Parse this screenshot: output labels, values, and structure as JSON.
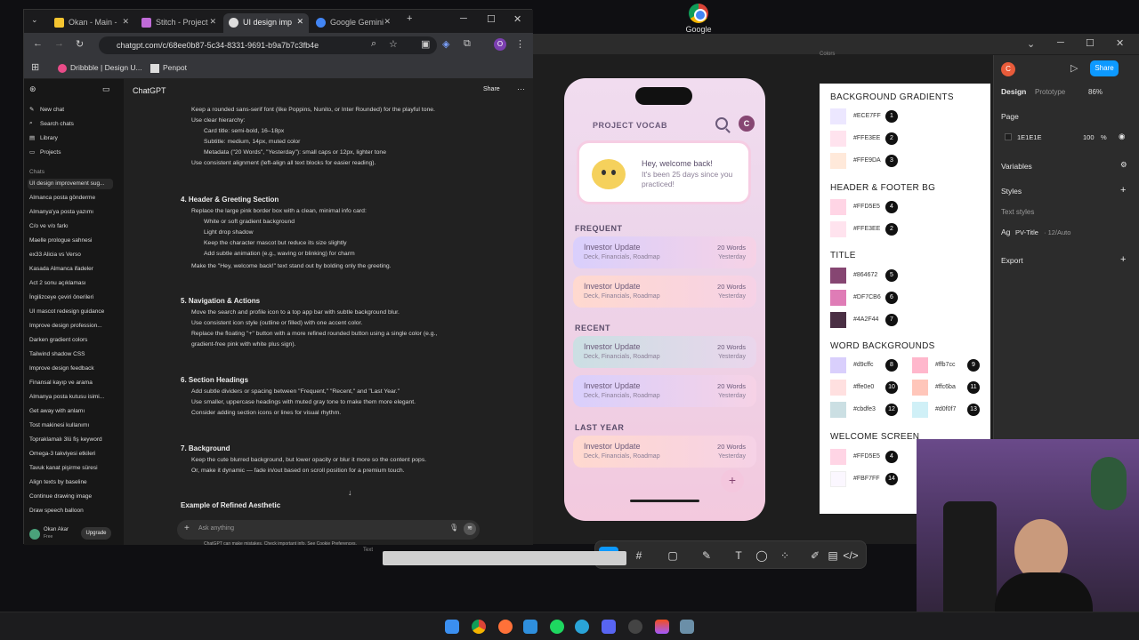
{
  "desktop": {
    "icon_label": "Google"
  },
  "browser": {
    "tabs": [
      {
        "label": "Okan - Main -"
      },
      {
        "label": "Stitch - Project"
      },
      {
        "label": "UI design imp"
      },
      {
        "label": "Google Gemini"
      }
    ],
    "url": "chatgpt.com/c/68ee0b87-5c34-8331-9691-b9a7b7c3fb4e",
    "bookmarks": [
      "Dribbble | Design U...",
      "Penpot"
    ],
    "profile_initial": "O"
  },
  "chatgpt": {
    "model_label": "ChatGPT",
    "share_label": "Share",
    "sidebar": {
      "actions": [
        "New chat",
        "Search chats",
        "Library",
        "Projects"
      ],
      "chats_header": "Chats",
      "chats": [
        "UI design improvement sug...",
        "Almanca posta gönderme",
        "Almanya'ya posta yazımı",
        "C/o ve v/o farkı",
        "Maelle prologue sahnesi",
        "ex33 Alicia vs Verso",
        "Kasada Almanca ifadeler",
        "Act 2 sonu açıklaması",
        "İngilizceye çeviri önerileri",
        "UI mascot redesign guidance",
        "Improve design profession...",
        "Darken gradient colors",
        "Tailwind shadow CSS",
        "Improve design feedback",
        "Finansal kayıp ve arama",
        "Almanya posta kutusu isimi...",
        "Get away with anlamı",
        "Tost makinesi kullanımı",
        "Topraklamalı 3lü fiş keyword",
        "Omega-3 takviyesi etkileri",
        "Tavuk kanat pişirme süresi",
        "Align texts by baseline",
        "Continue drawing image",
        "Draw speech balloon"
      ],
      "user_name": "Okan Akar",
      "user_plan": "Free",
      "upgrade_label": "Upgrade"
    },
    "content": {
      "lines_top": [
        "Keep a rounded sans-serif font (like Poppins, Nunito, or Inter Rounded) for the playful tone.",
        "Use clear hierarchy:",
        "Card title: semi-bold, 16–18px",
        "Subtitle: medium, 14px, muted color",
        "Metadata (\"20 Words\", \"Yesterday\"): small caps or 12px, lighter tone",
        "Use consistent alignment (left-align all text blocks for easier reading)."
      ],
      "s4_title": "4. Header & Greeting Section",
      "s4_lines": [
        "Replace the large pink border box with a clean, minimal info card:",
        "White or soft gradient background",
        "Light drop shadow",
        "Keep the character mascot but reduce its size slightly",
        "Add subtle animation (e.g., waving or blinking) for charm",
        "Make the \"Hey, welcome back!\" text stand out by bolding only the greeting."
      ],
      "s5_title": "5. Navigation & Actions",
      "s5_lines": [
        "Move the search and profile icon to a top app bar with subtle background blur.",
        "Use consistent icon style (outline or filled) with one accent color.",
        "Replace the floating \"+\" button with a more refined rounded button using a single color (e.g.,",
        "gradient-free pink with white plus sign)."
      ],
      "s6_title": "6. Section Headings",
      "s6_lines": [
        "Add subtle dividers or spacing between \"Frequent,\" \"Recent,\" and \"Last Year.\"",
        "Use smaller, uppercase headings with muted gray tone to make them more elegant.",
        "Consider adding section icons or lines for visual rhythm."
      ],
      "s7_title": "7. Background",
      "s7_lines": [
        "Keep the cute blurred background, but lower opacity or blur it more so the content pops.",
        "Or, make it dynamic — fade in/out based on scroll position for a premium touch."
      ],
      "example_title": "Example of Refined Aesthetic"
    },
    "ask_placeholder": "Ask anything",
    "disclaimer": "ChatGPT can make mistakes. Check important info. See Cookie Preferences."
  },
  "app": {
    "title": "PROJECT VOCAB",
    "avatar_initial": "C",
    "welcome_title": "Hey, welcome back!",
    "welcome_sub": "It's been 25 days since you practiced!",
    "sections": [
      {
        "name": "FREQUENT",
        "cards": [
          {
            "title": "Investor Update",
            "sub": "Deck, Financials, Roadmap",
            "words": "20 Words",
            "when": "Yesterday",
            "color": "#d9cffc"
          },
          {
            "title": "Investor Update",
            "sub": "Deck, Financials, Roadmap",
            "words": "20 Words",
            "when": "Yesterday",
            "color": "#ffc6ba"
          }
        ]
      },
      {
        "name": "RECENT",
        "cards": [
          {
            "title": "Investor Update",
            "sub": "Deck, Financials, Roadmap",
            "words": "20 Words",
            "when": "Yesterday",
            "color": "#cbdfe3"
          },
          {
            "title": "Investor Update",
            "sub": "Deck, Financials, Roadmap",
            "words": "20 Words",
            "when": "Yesterday",
            "color": "#d9cffc"
          }
        ]
      },
      {
        "name": "LAST YEAR",
        "cards": [
          {
            "title": "Investor Update",
            "sub": "Deck, Financials, Roadmap",
            "words": "20 Words",
            "when": "Yesterday",
            "color": "#ffc6ba"
          }
        ]
      }
    ],
    "fab": "+"
  },
  "palette": {
    "groups": [
      {
        "heading": "BACKGROUND GRADIENTS",
        "items": [
          {
            "hex": "#ECE7FF",
            "num": "1"
          },
          {
            "hex": "#FFE3EE",
            "num": "2"
          },
          {
            "hex": "#FFE9DA",
            "num": "3"
          }
        ]
      },
      {
        "heading": "HEADER & FOOTER BG",
        "items": [
          {
            "hex": "#FFD5E5",
            "num": "4"
          },
          {
            "hex": "#FFE3EE",
            "num": "2"
          }
        ]
      },
      {
        "heading": "TITLE",
        "items": [
          {
            "hex": "#864672",
            "num": "5"
          },
          {
            "hex": "#DF7CB6",
            "num": "6"
          },
          {
            "hex": "#4A2F44",
            "num": "7"
          }
        ]
      }
    ],
    "word_bg_heading": "WORD BACKGROUNDS",
    "word_bg": [
      {
        "hex": "#d9cffc",
        "num": "8"
      },
      {
        "hex": "#ffb7cc",
        "num": "9"
      },
      {
        "hex": "#ffe0e0",
        "num": "10"
      },
      {
        "hex": "#ffc6ba",
        "num": "11"
      },
      {
        "hex": "#cbdfe3",
        "num": "12"
      },
      {
        "hex": "#d0f0f7",
        "num": "13"
      }
    ],
    "welcome_heading": "WELCOME SCREEN",
    "welcome": [
      {
        "hex": "#FFD5E5",
        "num": "4"
      },
      {
        "hex": "#FBF7FF",
        "num": "14"
      }
    ]
  },
  "figma": {
    "user_initial": "C",
    "share_label": "Share",
    "tab_design": "Design",
    "tab_prototype": "Prototype",
    "zoom": "86%",
    "page_label": "Page",
    "page_color": "1E1E1E",
    "page_opacity": "100",
    "page_opacity_unit": "%",
    "variables_label": "Variables",
    "styles_label": "Styles",
    "text_styles_label": "Text styles",
    "text_style_name": "PV-Title",
    "text_style_meta": "· 12/Auto",
    "export_label": "Export",
    "canvas_label": "Colors",
    "frame_label": "Text"
  }
}
